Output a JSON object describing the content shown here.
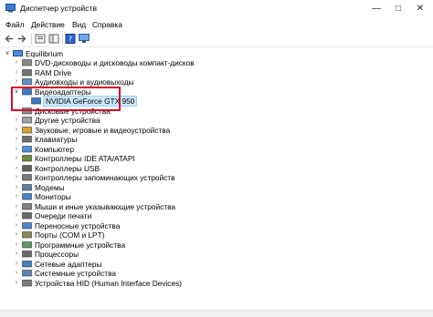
{
  "window": {
    "title": "Диспетчер устройств"
  },
  "menu": {
    "file": "Файл",
    "action": "Действие",
    "view": "Вид",
    "help": "Справка"
  },
  "tree": {
    "root": "Equilibrium",
    "items": [
      {
        "label": "DVD-дисководы и дисководы компакт-дисков",
        "icon": "dvd-icon"
      },
      {
        "label": "RAM Drive",
        "icon": "drive-icon"
      },
      {
        "label": "Аудиовходы и аудиовыходы",
        "icon": "audio-icon"
      },
      {
        "label": "Видеоадаптеры",
        "icon": "display-adapter-icon",
        "expanded": true
      },
      {
        "label": "NVIDIA GeForce GTX 950",
        "icon": "display-adapter-icon",
        "child": true
      },
      {
        "label": "Дисковые устройства",
        "icon": "disk-icon"
      },
      {
        "label": "Другие устройства",
        "icon": "unknown-device-icon"
      },
      {
        "label": "Звуковые, игровые и видеоустройства",
        "icon": "sound-icon"
      },
      {
        "label": "Клавиатуры",
        "icon": "keyboard-icon"
      },
      {
        "label": "Компьютер",
        "icon": "computer-icon"
      },
      {
        "label": "Контроллеры IDE ATA/ATAPI",
        "icon": "ide-icon"
      },
      {
        "label": "Контроллеры USB",
        "icon": "usb-icon"
      },
      {
        "label": "Контроллеры запоминающих устройств",
        "icon": "storage-icon"
      },
      {
        "label": "Модемы",
        "icon": "modem-icon"
      },
      {
        "label": "Мониторы",
        "icon": "monitor-icon"
      },
      {
        "label": "Мыши и иные указывающие устройства",
        "icon": "mouse-icon"
      },
      {
        "label": "Очереди печати",
        "icon": "printer-icon"
      },
      {
        "label": "Переносные устройства",
        "icon": "portable-icon"
      },
      {
        "label": "Порты (COM и LPT)",
        "icon": "port-icon"
      },
      {
        "label": "Программные устройства",
        "icon": "software-icon"
      },
      {
        "label": "Процессоры",
        "icon": "cpu-icon"
      },
      {
        "label": "Сетевые адаптеры",
        "icon": "network-icon"
      },
      {
        "label": "Системные устройства",
        "icon": "system-icon"
      },
      {
        "label": "Устройства HID (Human Interface Devices)",
        "icon": "hid-icon"
      }
    ]
  },
  "colors": {
    "highlight": "#d0102a",
    "selection": "#cce8ff"
  }
}
